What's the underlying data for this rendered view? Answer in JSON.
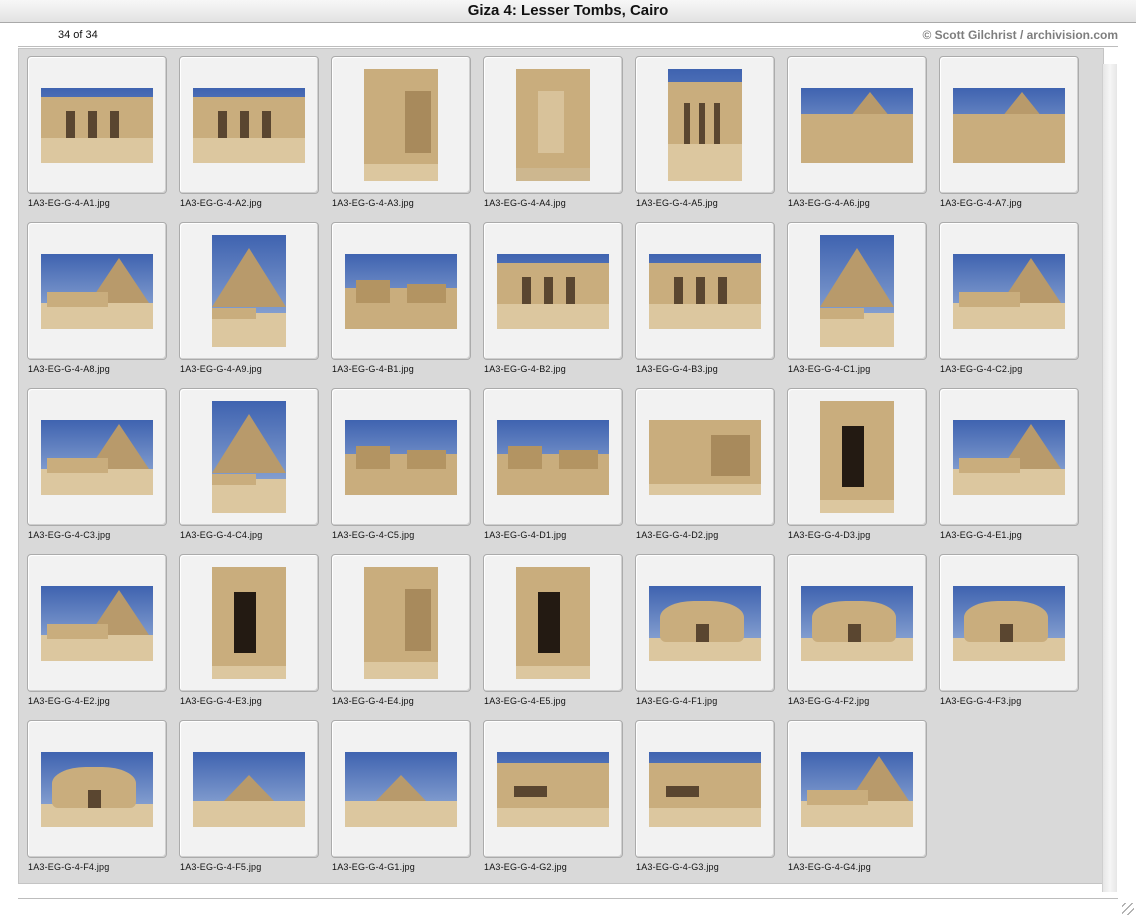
{
  "window": {
    "title": "Giza 4: Lesser Tombs, Cairo"
  },
  "header": {
    "count": "34 of 34",
    "credit": "© Scott Gilchrist / archivision.com"
  },
  "colors": {
    "sky": "#3f63b0",
    "stone": "#c9ad7d",
    "sand": "#dcc79f",
    "shadow": "#5a4630",
    "frame": "#f2f2f2",
    "panel": "#d9d9d9"
  },
  "thumbnails": [
    {
      "filename": "1A3-EG-G-4-A1.jpg",
      "orientation": "landscape",
      "motif": "facade"
    },
    {
      "filename": "1A3-EG-G-4-A2.jpg",
      "orientation": "landscape",
      "motif": "facade"
    },
    {
      "filename": "1A3-EG-G-4-A3.jpg",
      "orientation": "portrait",
      "motif": "wall"
    },
    {
      "filename": "1A3-EG-G-4-A4.jpg",
      "orientation": "portrait",
      "motif": "statue"
    },
    {
      "filename": "1A3-EG-G-4-A5.jpg",
      "orientation": "portrait",
      "motif": "facade"
    },
    {
      "filename": "1A3-EG-G-4-A6.jpg",
      "orientation": "landscape",
      "motif": "pyramid-blocks"
    },
    {
      "filename": "1A3-EG-G-4-A7.jpg",
      "orientation": "landscape",
      "motif": "pyramid-blocks"
    },
    {
      "filename": "1A3-EG-G-4-A8.jpg",
      "orientation": "landscape",
      "motif": "pyramid-ruins"
    },
    {
      "filename": "1A3-EG-G-4-A9.jpg",
      "orientation": "portrait",
      "motif": "pyramid"
    },
    {
      "filename": "1A3-EG-G-4-B1.jpg",
      "orientation": "landscape",
      "motif": "ruins"
    },
    {
      "filename": "1A3-EG-G-4-B2.jpg",
      "orientation": "landscape",
      "motif": "facade"
    },
    {
      "filename": "1A3-EG-G-4-B3.jpg",
      "orientation": "landscape",
      "motif": "facade"
    },
    {
      "filename": "1A3-EG-G-4-C1.jpg",
      "orientation": "portrait",
      "motif": "pyramid"
    },
    {
      "filename": "1A3-EG-G-4-C2.jpg",
      "orientation": "landscape",
      "motif": "pyramid-ruins"
    },
    {
      "filename": "1A3-EG-G-4-C3.jpg",
      "orientation": "landscape",
      "motif": "pyramid-ruins"
    },
    {
      "filename": "1A3-EG-G-4-C4.jpg",
      "orientation": "portrait",
      "motif": "pyramid"
    },
    {
      "filename": "1A3-EG-G-4-C5.jpg",
      "orientation": "landscape",
      "motif": "ruins"
    },
    {
      "filename": "1A3-EG-G-4-D1.jpg",
      "orientation": "landscape",
      "motif": "ruins"
    },
    {
      "filename": "1A3-EG-G-4-D2.jpg",
      "orientation": "landscape",
      "motif": "wall"
    },
    {
      "filename": "1A3-EG-G-4-D3.jpg",
      "orientation": "portrait",
      "motif": "doorway"
    },
    {
      "filename": "1A3-EG-G-4-E1.jpg",
      "orientation": "landscape",
      "motif": "pyramid-ruins"
    },
    {
      "filename": "1A3-EG-G-4-E2.jpg",
      "orientation": "landscape",
      "motif": "pyramid-ruins"
    },
    {
      "filename": "1A3-EG-G-4-E3.jpg",
      "orientation": "portrait",
      "motif": "doorway"
    },
    {
      "filename": "1A3-EG-G-4-E4.jpg",
      "orientation": "portrait",
      "motif": "wall"
    },
    {
      "filename": "1A3-EG-G-4-E5.jpg",
      "orientation": "portrait",
      "motif": "doorway"
    },
    {
      "filename": "1A3-EG-G-4-F1.jpg",
      "orientation": "landscape",
      "motif": "rock"
    },
    {
      "filename": "1A3-EG-G-4-F2.jpg",
      "orientation": "landscape",
      "motif": "rock"
    },
    {
      "filename": "1A3-EG-G-4-F3.jpg",
      "orientation": "landscape",
      "motif": "rock"
    },
    {
      "filename": "1A3-EG-G-4-F4.jpg",
      "orientation": "landscape",
      "motif": "rock"
    },
    {
      "filename": "1A3-EG-G-4-F5.jpg",
      "orientation": "landscape",
      "motif": "pyramid-distant"
    },
    {
      "filename": "1A3-EG-G-4-G1.jpg",
      "orientation": "landscape",
      "motif": "pyramid-distant"
    },
    {
      "filename": "1A3-EG-G-4-G2.jpg",
      "orientation": "landscape",
      "motif": "quarry"
    },
    {
      "filename": "1A3-EG-G-4-G3.jpg",
      "orientation": "landscape",
      "motif": "quarry"
    },
    {
      "filename": "1A3-EG-G-4-G4.jpg",
      "orientation": "landscape",
      "motif": "pyramid-ruins"
    }
  ]
}
